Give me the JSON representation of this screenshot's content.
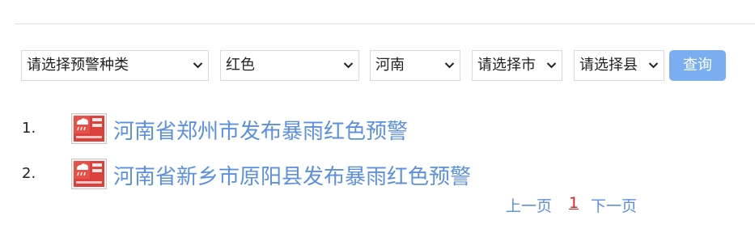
{
  "filters": {
    "warning_type": "请选择预警种类",
    "color": "红色",
    "province": "河南",
    "city": "请选择市",
    "county": "请选择县",
    "query_label": "查询"
  },
  "results": [
    {
      "index": "1.",
      "title": "河南省郑州市发布暴雨红色预警",
      "icon": "rainstorm-red-warning-icon"
    },
    {
      "index": "2.",
      "title": "河南省新乡市原阳县发布暴雨红色预警",
      "icon": "rainstorm-red-warning-icon"
    }
  ],
  "pagination": {
    "prev_label": "上一页",
    "current_page": "1",
    "next_label": "下一页"
  },
  "colors": {
    "link": "#5b8fe0",
    "button": "#7aaef0",
    "current_page": "#e02020",
    "badge_red": "#d9413a"
  }
}
